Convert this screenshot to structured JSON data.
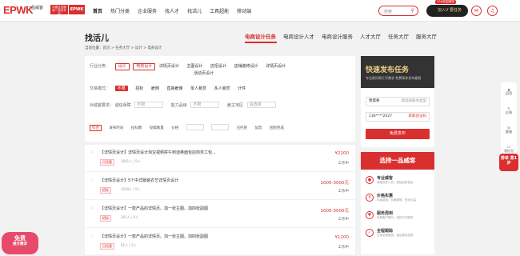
{
  "brand": {
    "logo": "EPWK",
    "logo_sub": "一品威客",
    "logo_url": "epwk.com",
    "badge": "中国企业服务一站式平台",
    "epwk": "EPWK"
  },
  "nav": [
    "首页",
    "热门分类",
    "企业服务",
    "找人才",
    "找活儿",
    "工具超能",
    "移动端"
  ],
  "header": {
    "search_placeholder": "搜索",
    "search_icon": "search-icon",
    "vip_label": "加入V 要任务",
    "vip_tag": "10大权益服务"
  },
  "page": {
    "title": "找活儿",
    "breadcrumb": "当前位置：首页 > 任务大厅 > 设计 > 电商设计"
  },
  "tabs": [
    "电商设计任务",
    "电商设计人才",
    "电商设计服务",
    "人才大厅",
    "任务大厅",
    "服务大厅"
  ],
  "filter": {
    "industry_label": "行业分类：",
    "industry_sel": [
      "设计",
      "电商设计"
    ],
    "industry_opts": [
      "详情页设计",
      "主图设计",
      "店招设计",
      "店铺装修设计",
      "详情页设计",
      "活动页设计"
    ],
    "mode_label": "交易模式：",
    "mode_opts": [
      "不限",
      "招标",
      "雇佣",
      "直接雇佣",
      "单人悬赏",
      "多人悬赏",
      "计件"
    ],
    "req_label": "对威客要求：",
    "req1": "诚信保障",
    "req1_sel": "不限",
    "req2": "能力品级",
    "req2_sel": "不限",
    "req3": "雇主地区",
    "req3_sel": "请选择",
    "sort": [
      "综合",
      "发布时间",
      "投标数",
      "投稿数量",
      "价格"
    ],
    "sort_price": "元",
    "checks": [
      "已托管",
      "加急",
      "团购完成"
    ]
  },
  "tasks": [
    {
      "title": "【详情页设计】详情页设计淘宝视频拼午到迪奥面包店商务工包...",
      "tag": "已托管",
      "meta": "1641人  |  5人",
      "price": "¥2200",
      "status": "工作中"
    },
    {
      "title": "【详情页设计】5个中式服装衣艺详情页设计",
      "tag": "招标",
      "meta": "3209人  |  5人",
      "price": "1000-3000元",
      "status": "工作中"
    },
    {
      "title": "【详情页设计】一款产品的详情页。加一张主图。加四张副图",
      "tag": "招标",
      "meta": "361人  |  4人",
      "price": "1000-3000元",
      "status": "工作中"
    },
    {
      "title": "【详情页设计】一款产品的详情页。加一张主图。加四张副图",
      "tag": "已托管",
      "meta": "61人  |  1人",
      "price": "¥1200",
      "status": "工作中"
    }
  ],
  "post": {
    "title": "快速发布任务",
    "subtitle": "专业顾问帮忙写需求  免费帮你发布雇佣",
    "field1": "我需要",
    "field1_hint": "请选择服务类型",
    "field2": "136****2027",
    "field2_hint": "获取验证码",
    "button": "免费发布"
  },
  "why": {
    "title": "选择一品威客",
    "items": [
      {
        "a": "专业威客",
        "b": "海量优秀人员，诚信品质保证"
      },
      {
        "a": "价格实惠",
        "b": "手续费用，价格透明，性价比高"
      },
      {
        "a": "服务周到",
        "b": "专属客户顾问，多种方式服务"
      },
      {
        "a": "全程跟踪",
        "b": "交易全程跟进，保证服务品质"
      }
    ]
  },
  "toolbar": [
    "回顶",
    "反馈",
    "客服",
    "领红包"
  ],
  "promo": "排单\n第1步",
  "free": {
    "a": "免费",
    "b": "提交需求"
  },
  "bottom_peek": "选择一品威客"
}
